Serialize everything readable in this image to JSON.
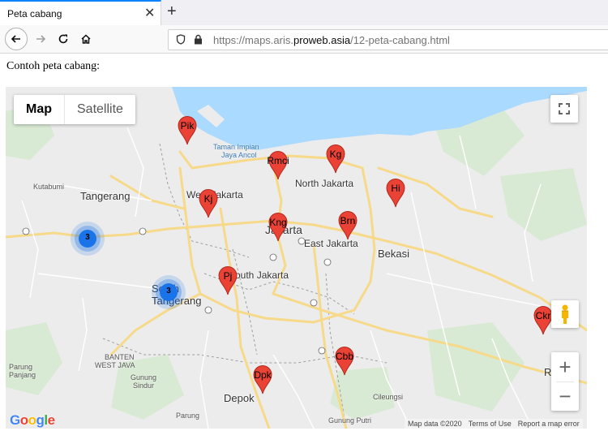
{
  "browser": {
    "tab_title": "Peta cabang",
    "close_glyph": "✕",
    "new_tab_glyph": "+",
    "url_prefix": "https://maps.aris.",
    "url_host": "proweb.asia",
    "url_path": "/12-peta-cabang.html"
  },
  "page": {
    "heading": "Contoh peta cabang:"
  },
  "map": {
    "map_type": {
      "map_label": "Map",
      "satellite_label": "Satellite",
      "selected": "Map"
    },
    "zoom_in_glyph": "+",
    "zoom_out_glyph": "−",
    "place_labels": {
      "taman_impian": "Taman Impian",
      "jaya_ancol": "Jaya Ancol",
      "north_jakarta": "North Jakarta",
      "kutabumi": "Kutabumi",
      "tangerang": "Tangerang",
      "west_jakarta": "West Jakarta",
      "jakarta": "Jakarta",
      "east_jakarta": "East Jakarta",
      "bekasi": "Bekasi",
      "south_jakarta": "South Jakarta",
      "south_tangerang": "South Tangerang",
      "banten": "BANTEN",
      "west_java": "WEST JAVA",
      "parung_panjang": "Parung Panjang",
      "gunung_sindur": "Gunung Sindur",
      "depok": "Depok",
      "cileungsi": "Cileungsi",
      "gunung_putri": "Gunung Putri",
      "parung": "Parung",
      "ri": "R",
      "ri2": "Ri"
    },
    "markers": [
      {
        "label": "Pik"
      },
      {
        "label": "Rmci"
      },
      {
        "label": "Kg"
      },
      {
        "label": "Hi"
      },
      {
        "label": "Kj"
      },
      {
        "label": "Kng"
      },
      {
        "label": "Brn"
      },
      {
        "label": "Pj"
      },
      {
        "label": "Cbb"
      },
      {
        "label": "Dpk"
      },
      {
        "label": "Ckr"
      }
    ],
    "clusters": [
      {
        "count": "3"
      },
      {
        "count": "3"
      }
    ],
    "attribution": {
      "google": "Google",
      "map_data": "Map data ©2020",
      "terms": "Terms of Use",
      "report": "Report a map error"
    },
    "colors": {
      "marker_red": "#ea4335",
      "cluster_blue": "#1a73e8",
      "water": "#aadaff",
      "land": "#ededed",
      "park": "#c8e6c0"
    }
  }
}
